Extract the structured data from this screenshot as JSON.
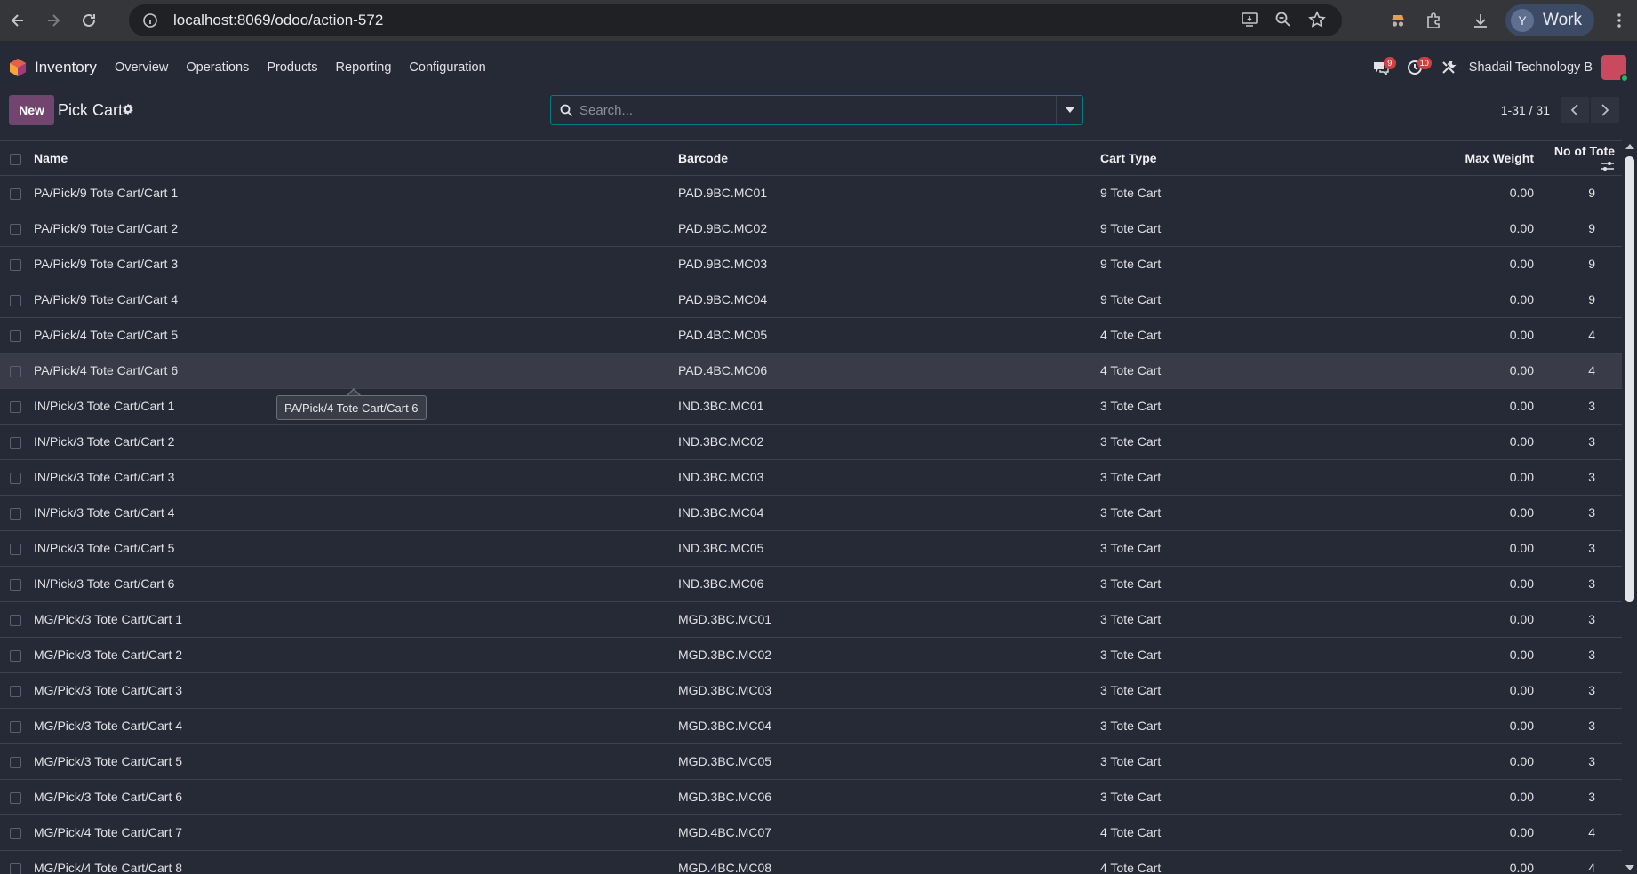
{
  "browser": {
    "url": "localhost:8069/odoo/action-572",
    "profile_initial": "Y",
    "profile_name": "Work"
  },
  "navbar": {
    "app_name": "Inventory",
    "menu": [
      "Overview",
      "Operations",
      "Products",
      "Reporting",
      "Configuration"
    ],
    "messages_count": "9",
    "activities_count": "10",
    "company": "Shadail Technology B"
  },
  "control_panel": {
    "new_label": "New",
    "title": "Pick Cart",
    "search_placeholder": "Search...",
    "pager": "1-31 / 31"
  },
  "table": {
    "headers": {
      "name": "Name",
      "barcode": "Barcode",
      "cart_type": "Cart Type",
      "max_weight": "Max Weight",
      "no_of_tote": "No of Tote"
    },
    "rows": [
      {
        "name": "PA/Pick/9 Tote Cart/Cart 1",
        "barcode": "PAD.9BC.MC01",
        "cart_type": "9 Tote Cart",
        "max_weight": "0.00",
        "no_of_tote": "9"
      },
      {
        "name": "PA/Pick/9 Tote Cart/Cart 2",
        "barcode": "PAD.9BC.MC02",
        "cart_type": "9 Tote Cart",
        "max_weight": "0.00",
        "no_of_tote": "9"
      },
      {
        "name": "PA/Pick/9 Tote Cart/Cart 3",
        "barcode": "PAD.9BC.MC03",
        "cart_type": "9 Tote Cart",
        "max_weight": "0.00",
        "no_of_tote": "9"
      },
      {
        "name": "PA/Pick/9 Tote Cart/Cart 4",
        "barcode": "PAD.9BC.MC04",
        "cart_type": "9 Tote Cart",
        "max_weight": "0.00",
        "no_of_tote": "9"
      },
      {
        "name": "PA/Pick/4 Tote Cart/Cart 5",
        "barcode": "PAD.4BC.MC05",
        "cart_type": "4 Tote Cart",
        "max_weight": "0.00",
        "no_of_tote": "4"
      },
      {
        "name": "PA/Pick/4 Tote Cart/Cart 6",
        "barcode": "PAD.4BC.MC06",
        "cart_type": "4 Tote Cart",
        "max_weight": "0.00",
        "no_of_tote": "4"
      },
      {
        "name": "IN/Pick/3 Tote Cart/Cart 1",
        "barcode": "IND.3BC.MC01",
        "cart_type": "3 Tote Cart",
        "max_weight": "0.00",
        "no_of_tote": "3"
      },
      {
        "name": "IN/Pick/3 Tote Cart/Cart 2",
        "barcode": "IND.3BC.MC02",
        "cart_type": "3 Tote Cart",
        "max_weight": "0.00",
        "no_of_tote": "3"
      },
      {
        "name": "IN/Pick/3 Tote Cart/Cart 3",
        "barcode": "IND.3BC.MC03",
        "cart_type": "3 Tote Cart",
        "max_weight": "0.00",
        "no_of_tote": "3"
      },
      {
        "name": "IN/Pick/3 Tote Cart/Cart 4",
        "barcode": "IND.3BC.MC04",
        "cart_type": "3 Tote Cart",
        "max_weight": "0.00",
        "no_of_tote": "3"
      },
      {
        "name": "IN/Pick/3 Tote Cart/Cart 5",
        "barcode": "IND.3BC.MC05",
        "cart_type": "3 Tote Cart",
        "max_weight": "0.00",
        "no_of_tote": "3"
      },
      {
        "name": "IN/Pick/3 Tote Cart/Cart 6",
        "barcode": "IND.3BC.MC06",
        "cart_type": "3 Tote Cart",
        "max_weight": "0.00",
        "no_of_tote": "3"
      },
      {
        "name": "MG/Pick/3 Tote Cart/Cart 1",
        "barcode": "MGD.3BC.MC01",
        "cart_type": "3 Tote Cart",
        "max_weight": "0.00",
        "no_of_tote": "3"
      },
      {
        "name": "MG/Pick/3 Tote Cart/Cart 2",
        "barcode": "MGD.3BC.MC02",
        "cart_type": "3 Tote Cart",
        "max_weight": "0.00",
        "no_of_tote": "3"
      },
      {
        "name": "MG/Pick/3 Tote Cart/Cart 3",
        "barcode": "MGD.3BC.MC03",
        "cart_type": "3 Tote Cart",
        "max_weight": "0.00",
        "no_of_tote": "3"
      },
      {
        "name": "MG/Pick/3 Tote Cart/Cart 4",
        "barcode": "MGD.3BC.MC04",
        "cart_type": "3 Tote Cart",
        "max_weight": "0.00",
        "no_of_tote": "3"
      },
      {
        "name": "MG/Pick/3 Tote Cart/Cart 5",
        "barcode": "MGD.3BC.MC05",
        "cart_type": "3 Tote Cart",
        "max_weight": "0.00",
        "no_of_tote": "3"
      },
      {
        "name": "MG/Pick/3 Tote Cart/Cart 6",
        "barcode": "MGD.3BC.MC06",
        "cart_type": "3 Tote Cart",
        "max_weight": "0.00",
        "no_of_tote": "3"
      },
      {
        "name": "MG/Pick/4 Tote Cart/Cart 7",
        "barcode": "MGD.4BC.MC07",
        "cart_type": "4 Tote Cart",
        "max_weight": "0.00",
        "no_of_tote": "4"
      },
      {
        "name": "MG/Pick/4 Tote Cart/Cart 8",
        "barcode": "MGD.4BC.MC08",
        "cart_type": "4 Tote Cart",
        "max_weight": "0.00",
        "no_of_tote": "4"
      }
    ]
  },
  "tooltip": {
    "text": "PA/Pick/4 Tote Cart/Cart 6"
  },
  "colors": {
    "background": "#262a36",
    "accent": "#71456d",
    "search_border": "#017e84",
    "badge": "#d23f3f"
  }
}
